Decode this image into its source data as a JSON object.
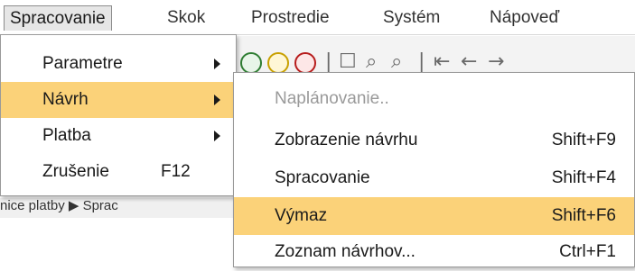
{
  "menubar": {
    "items": [
      {
        "label": "Spracovanie",
        "active": true
      },
      {
        "label": "Skok"
      },
      {
        "label": "Prostredie"
      },
      {
        "label": "Systém"
      },
      {
        "label": "Nápoveď"
      }
    ]
  },
  "menu": {
    "items": [
      {
        "label": "Parametre",
        "shortcut": "",
        "submenu": true
      },
      {
        "label": "Návrh",
        "shortcut": "",
        "submenu": true,
        "highlighted": true
      },
      {
        "label": "Platba",
        "shortcut": "",
        "submenu": true
      },
      {
        "label": "Zrušenie",
        "shortcut": "F12",
        "submenu": false
      }
    ]
  },
  "submenu": {
    "items": [
      {
        "label": "Naplánovanie..",
        "shortcut": "",
        "disabled": true
      },
      {
        "label": "Zobrazenie návrhu",
        "shortcut": "Shift+F9"
      },
      {
        "label": "Spracovanie",
        "shortcut": "Shift+F4"
      },
      {
        "label": "Výmaz",
        "shortcut": "Shift+F6",
        "highlighted": true
      },
      {
        "label": "Zoznam návrhov...",
        "shortcut": "Ctrl+F1"
      }
    ]
  },
  "background": {
    "strip_text": "nice platby    ▶ Sprac"
  },
  "colors": {
    "highlight": "#fbd279",
    "disabled_text": "#9a9a9a",
    "text": "#1a1a1a"
  }
}
